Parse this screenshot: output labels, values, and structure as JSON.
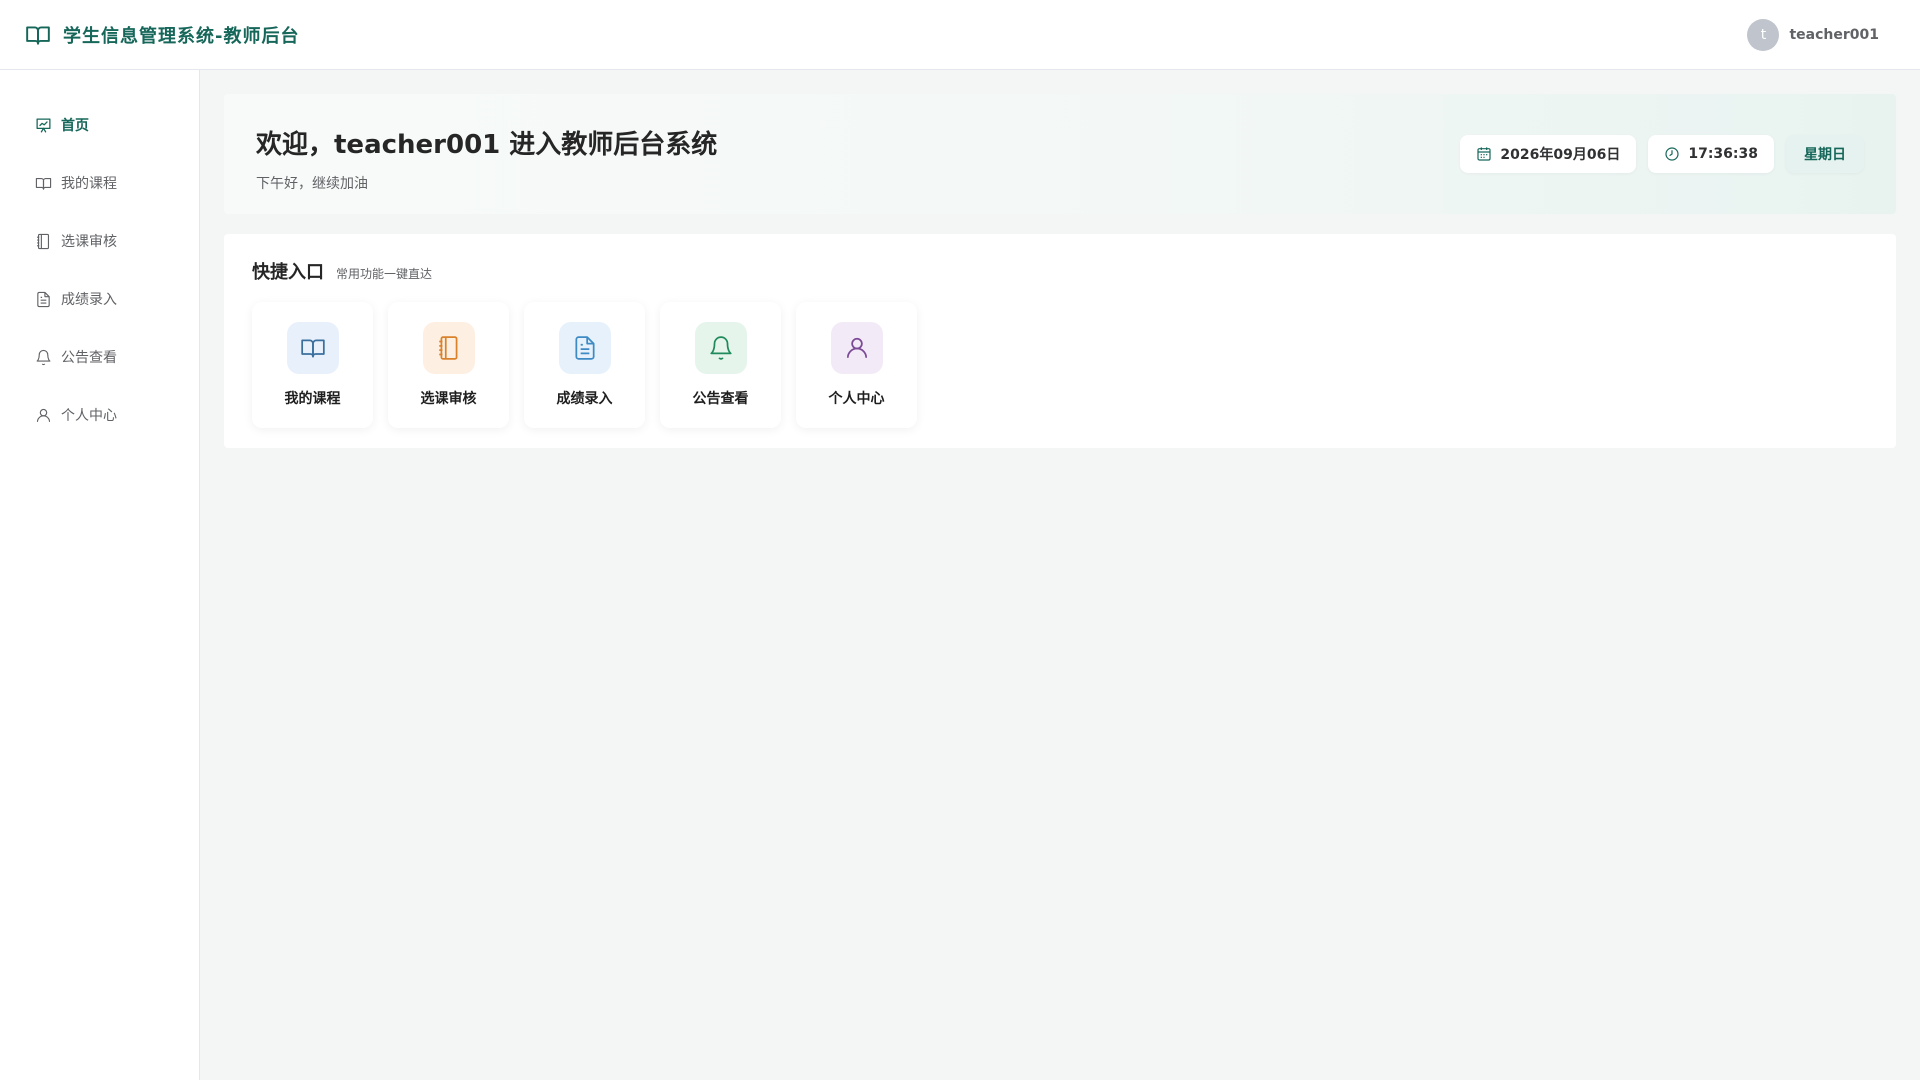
{
  "header": {
    "title": "学生信息管理系统-教师后台",
    "brand_icon": "book-open-icon",
    "avatar_letter": "t",
    "username": "teacher001"
  },
  "sidebar": {
    "items": [
      {
        "label": "首页",
        "icon": "presentation-chart-icon",
        "active": true
      },
      {
        "label": "我的课程",
        "icon": "book-open-icon",
        "active": false
      },
      {
        "label": "选课审核",
        "icon": "notebook-icon",
        "active": false
      },
      {
        "label": "成绩录入",
        "icon": "document-icon",
        "active": false
      },
      {
        "label": "公告查看",
        "icon": "bell-icon",
        "active": false
      },
      {
        "label": "个人中心",
        "icon": "user-icon",
        "active": false
      }
    ]
  },
  "welcome": {
    "title": "欢迎，teacher001 进入教师后台系统",
    "subtitle": "下午好，继续加油",
    "date": "2026年09月06日",
    "time": "17:36:38",
    "weekday": "星期日"
  },
  "quick": {
    "title": "快捷入口",
    "subtitle": "常用功能一键直达",
    "cards": [
      {
        "label": "我的课程",
        "icon": "book-open-icon",
        "bg": "#e8f1fb",
        "color": "#3a6f9e"
      },
      {
        "label": "选课审核",
        "icon": "notebook-icon",
        "bg": "#fdf0e3",
        "color": "#d9822b"
      },
      {
        "label": "成绩录入",
        "icon": "document-icon",
        "bg": "#e6f1fb",
        "color": "#3d8ac4"
      },
      {
        "label": "公告查看",
        "icon": "bell-icon",
        "bg": "#e5f5ec",
        "color": "#1f8a5a"
      },
      {
        "label": "个人中心",
        "icon": "user-icon",
        "bg": "#f3eaf7",
        "color": "#7b4a96"
      }
    ]
  },
  "colors": {
    "accent": "#16675a",
    "text_muted": "#606266"
  }
}
